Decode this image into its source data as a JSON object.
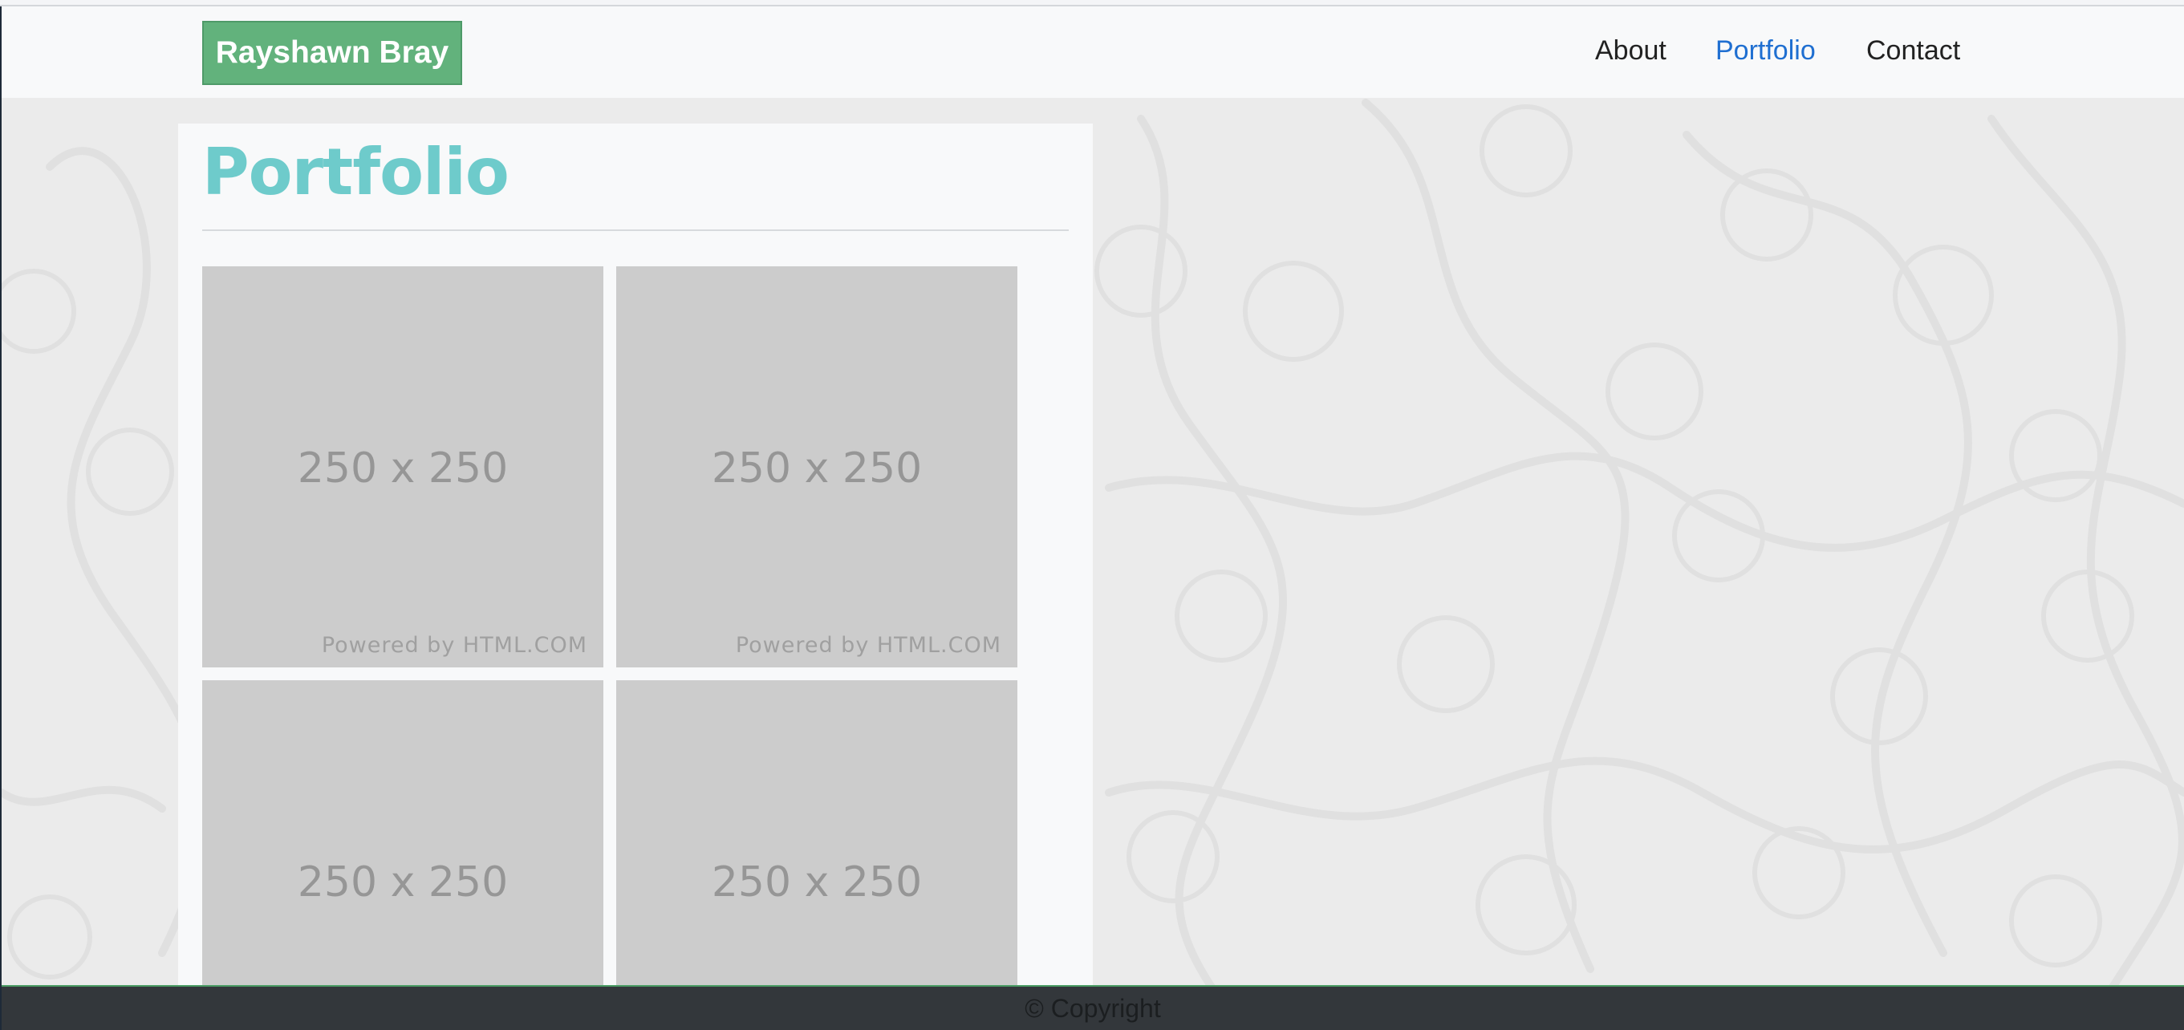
{
  "navbar": {
    "brand": "Rayshawn Bray",
    "links": [
      {
        "label": "About",
        "active": false
      },
      {
        "label": "Portfolio",
        "active": true
      },
      {
        "label": "Contact",
        "active": false
      }
    ]
  },
  "main": {
    "title": "Portfolio",
    "thumbnails": [
      {
        "size_label": "250 x 250",
        "credit": "Powered by HTML.COM"
      },
      {
        "size_label": "250 x 250",
        "credit": "Powered by HTML.COM"
      },
      {
        "size_label": "250 x 250",
        "credit": ""
      },
      {
        "size_label": "250 x 250",
        "credit": ""
      }
    ]
  },
  "footer": {
    "text": "© Copyright"
  },
  "colors": {
    "brand_bg": "#62b27c",
    "title": "#6ecbcb",
    "active_link": "#1f6fd1",
    "footer_bg": "#33373b"
  }
}
